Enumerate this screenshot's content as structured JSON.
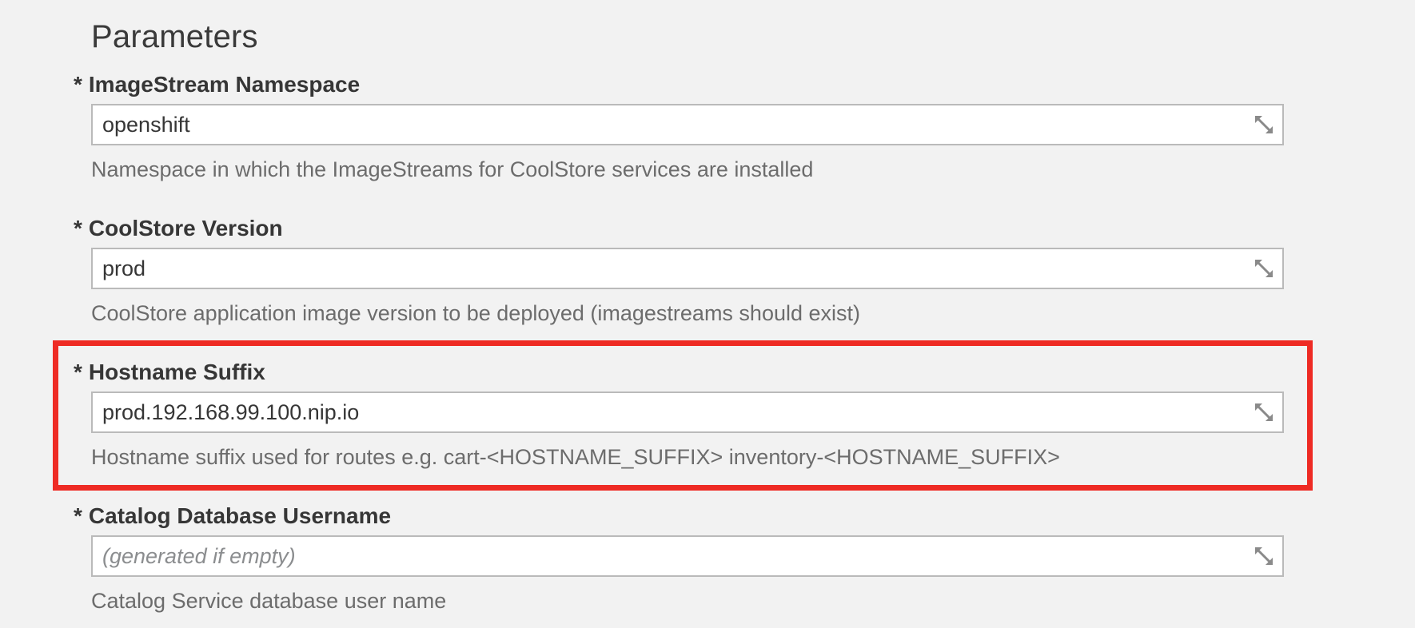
{
  "section": {
    "title": "Parameters"
  },
  "params": [
    {
      "required_mark": "*",
      "label": "ImageStream Namespace",
      "value": "openshift",
      "placeholder": "",
      "help": "Namespace in which the ImageStreams for CoolStore services are installed"
    },
    {
      "required_mark": "*",
      "label": "CoolStore Version",
      "value": "prod",
      "placeholder": "",
      "help": "CoolStore application image version to be deployed (imagestreams should exist)"
    },
    {
      "required_mark": "*",
      "label": "Hostname Suffix",
      "value": "prod.192.168.99.100.nip.io",
      "placeholder": "",
      "help": "Hostname suffix used for routes e.g. cart-<HOSTNAME_SUFFIX> inventory-<HOSTNAME_SUFFIX>"
    },
    {
      "required_mark": "*",
      "label": "Catalog Database Username",
      "value": "",
      "placeholder": "(generated if empty)",
      "help": "Catalog Service database user name"
    }
  ],
  "icons": {
    "resize": "expand-resize-icon"
  },
  "colors": {
    "highlight": "#ee2b24",
    "background": "#f2f2f2"
  }
}
